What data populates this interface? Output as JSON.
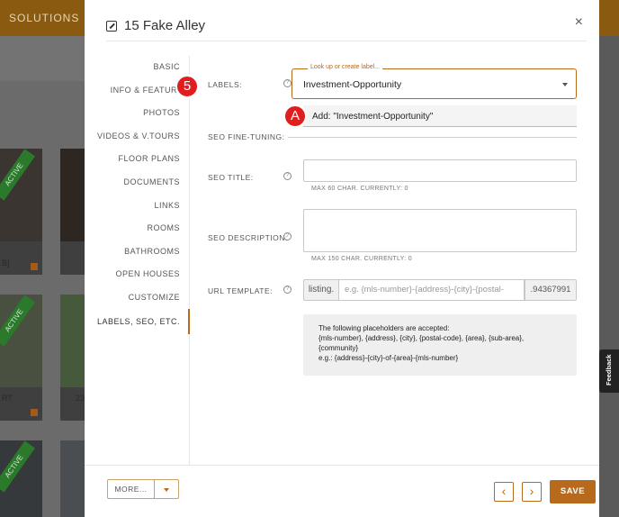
{
  "background": {
    "brand": "SOLUTIONS",
    "badges": [
      "ACTIVE",
      "ACTIVE",
      "ACTIVE"
    ],
    "texts": [
      "B]",
      "RT",
      "23"
    ]
  },
  "modal": {
    "title": "15 Fake Alley",
    "close_label": "×"
  },
  "sidenav": {
    "items": [
      {
        "label": "BASIC"
      },
      {
        "label": "INFO & FEATURES"
      },
      {
        "label": "PHOTOS"
      },
      {
        "label": "VIDEOS & V.TOURS"
      },
      {
        "label": "FLOOR PLANS"
      },
      {
        "label": "DOCUMENTS"
      },
      {
        "label": "LINKS"
      },
      {
        "label": "ROOMS"
      },
      {
        "label": "BATHROOMS"
      },
      {
        "label": "OPEN HOUSES"
      },
      {
        "label": "CUSTOMIZE"
      },
      {
        "label": "LABELS, SEO, ETC."
      }
    ],
    "active": "LABELS, SEO, ETC."
  },
  "form": {
    "labels": {
      "label": "LABELS:",
      "legend": "Look up or create label...",
      "value": "Investment-Opportunity",
      "option": "Add: \"Investment-Opportunity\""
    },
    "seo_heading": "SEO FINE-TUNING:",
    "seo_title": {
      "label": "SEO TITLE:",
      "value": "",
      "hint": "MAX 60 CHAR. CURRENTLY: 0"
    },
    "seo_description": {
      "label": "SEO DESCRIPTION:",
      "value": "",
      "hint": "MAX 150 CHAR. CURRENTLY: 0"
    },
    "url_template": {
      "label": "URL TEMPLATE:",
      "prefix": "listing.",
      "placeholder": "e.g. {mls-number}-{address}-{city}-{postal-",
      "suffix": ".94367991"
    },
    "help_glyph": "?",
    "info": {
      "line1": "The following placeholders are accepted:",
      "line2": "{mls-number}, {address}, {city}, {postal-code}, {area}, {sub-area},",
      "line3": "{community}",
      "line4": "e.g.: {address}-{city}-of-{area}-{mls-number}"
    }
  },
  "footer": {
    "more_label": "MORE...",
    "prev_label": "‹",
    "next_label": "›",
    "save_label": "SAVE"
  },
  "annotations": {
    "step": "5",
    "option_marker": "A"
  },
  "feedback_label": "Feedback",
  "colors": {
    "accent": "#b86a1c",
    "marker": "#e01e1e",
    "active_ribbon": "#2b7a2b"
  },
  "icons": [
    "edit-icon",
    "help-icon",
    "caret-down-icon",
    "chevron-left-icon",
    "chevron-right-icon",
    "close-icon"
  ]
}
